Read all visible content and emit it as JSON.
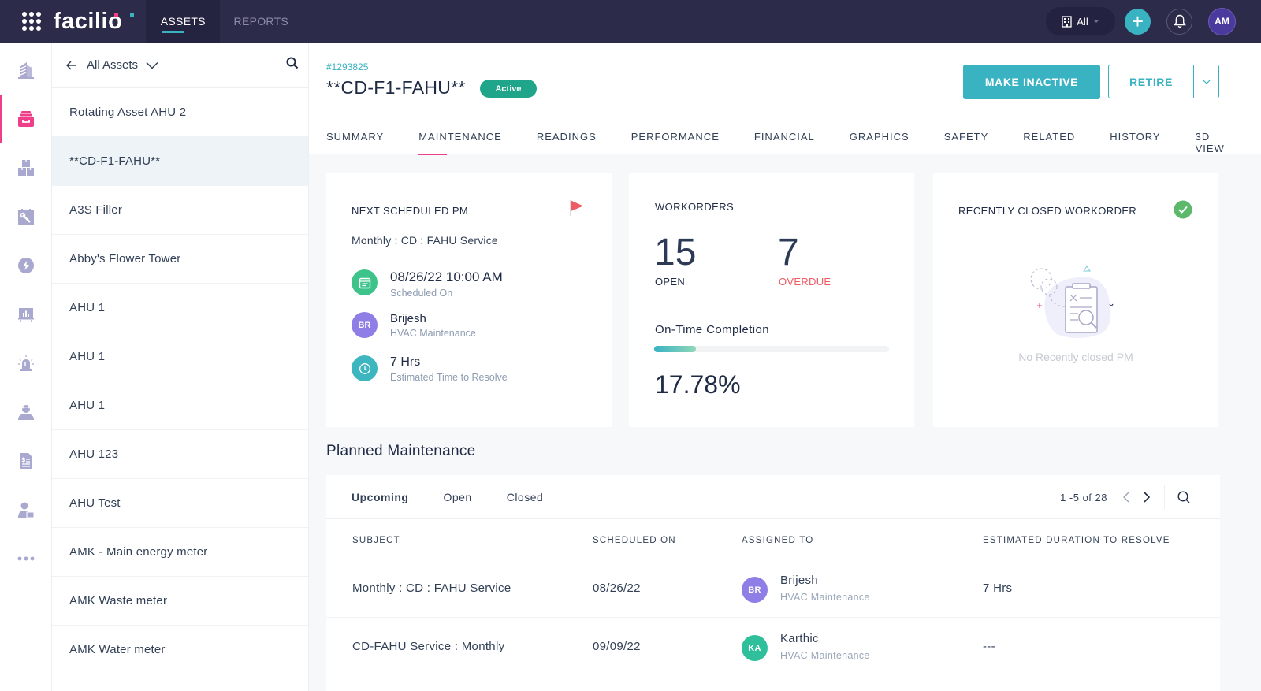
{
  "topbar": {
    "brand": "facilio",
    "tabs": [
      {
        "label": "ASSETS",
        "active": true
      },
      {
        "label": "REPORTS",
        "active": false
      }
    ],
    "site_selector": "All",
    "user_initials": "AM"
  },
  "rail": {
    "items": [
      {
        "icon": "building-icon",
        "active": false
      },
      {
        "icon": "asset-box-icon",
        "active": true
      },
      {
        "icon": "inventory-icon",
        "active": false
      },
      {
        "icon": "maintenance-calendar-icon",
        "active": false
      },
      {
        "icon": "energy-icon",
        "active": false
      },
      {
        "icon": "dashboard-icon",
        "active": false
      },
      {
        "icon": "alarm-icon",
        "active": false
      },
      {
        "icon": "people-icon",
        "active": false
      },
      {
        "icon": "invoice-icon",
        "active": false
      },
      {
        "icon": "vendor-icon",
        "active": false
      },
      {
        "icon": "more-icon",
        "active": false
      }
    ]
  },
  "asset_list": {
    "title": "All Assets",
    "items": [
      {
        "name": "Rotating Asset AHU 2",
        "selected": false
      },
      {
        "name": "**CD-F1-FAHU**",
        "selected": true
      },
      {
        "name": "A3S Filler",
        "selected": false
      },
      {
        "name": "Abby's Flower Tower",
        "selected": false
      },
      {
        "name": "AHU 1",
        "selected": false
      },
      {
        "name": "AHU 1",
        "selected": false
      },
      {
        "name": "AHU 1",
        "selected": false
      },
      {
        "name": "AHU 123",
        "selected": false
      },
      {
        "name": "AHU Test",
        "selected": false
      },
      {
        "name": "AMK - Main energy meter",
        "selected": false
      },
      {
        "name": "AMK Waste meter",
        "selected": false
      },
      {
        "name": "AMK Water meter",
        "selected": false
      }
    ]
  },
  "asset": {
    "id": "#1293825",
    "name": "**CD-F1-FAHU**",
    "status": "Active",
    "status_color": "#1fa58a",
    "actions": {
      "primary": "MAKE INACTIVE",
      "secondary": "RETIRE"
    }
  },
  "tabs": [
    {
      "label": "SUMMARY",
      "active": false
    },
    {
      "label": "MAINTENANCE",
      "active": true
    },
    {
      "label": "READINGS",
      "active": false
    },
    {
      "label": "PERFORMANCE",
      "active": false
    },
    {
      "label": "FINANCIAL",
      "active": false
    },
    {
      "label": "GRAPHICS",
      "active": false
    },
    {
      "label": "SAFETY",
      "active": false
    },
    {
      "label": "RELATED",
      "active": false
    },
    {
      "label": "HISTORY",
      "active": false
    },
    {
      "label": "3D VIEW",
      "active": false
    }
  ],
  "next_pm": {
    "title": "NEXT SCHEDULED PM",
    "subject": "Monthly : CD : FAHU Service",
    "scheduled": {
      "value": "08/26/22 10:00 AM",
      "label": "Scheduled On"
    },
    "assignee": {
      "initials": "BR",
      "name": "Brijesh",
      "team": "HVAC Maintenance"
    },
    "duration": {
      "value": "7 Hrs",
      "label": "Estimated Time to Resolve"
    }
  },
  "workorders": {
    "title": "WORKORDERS",
    "open": {
      "value": "15",
      "label": "OPEN"
    },
    "overdue": {
      "value": "7",
      "label": "OVERDUE"
    },
    "on_time_label": "On-Time Completion",
    "on_time_percent": 17.78,
    "on_time_text": "17.78%"
  },
  "recently_closed": {
    "title": "RECENTLY CLOSED WORKORDER",
    "empty_text": "No Recently closed PM"
  },
  "planned_maintenance": {
    "heading": "Planned Maintenance",
    "tabs": [
      {
        "label": "Upcoming",
        "active": true
      },
      {
        "label": "Open",
        "active": false
      },
      {
        "label": "Closed",
        "active": false
      }
    ],
    "pagination": "1 -5 of 28",
    "columns": [
      "SUBJECT",
      "SCHEDULED ON",
      "ASSIGNED TO",
      "ESTIMATED DURATION TO RESOLVE"
    ],
    "rows": [
      {
        "subject": "Monthly : CD : FAHU Service",
        "scheduled_on": "08/26/22",
        "assignee_initials": "BR",
        "assignee_name": "Brijesh",
        "assignee_team": "HVAC Maintenance",
        "avatar_color": "#8f7ee6",
        "duration": "7 Hrs"
      },
      {
        "subject": "CD-FAHU Service : Monthly",
        "scheduled_on": "09/09/22",
        "assignee_initials": "KA",
        "assignee_name": "Karthic",
        "assignee_team": "HVAC Maintenance",
        "avatar_color": "#2fbf9b",
        "duration": "---"
      }
    ]
  }
}
